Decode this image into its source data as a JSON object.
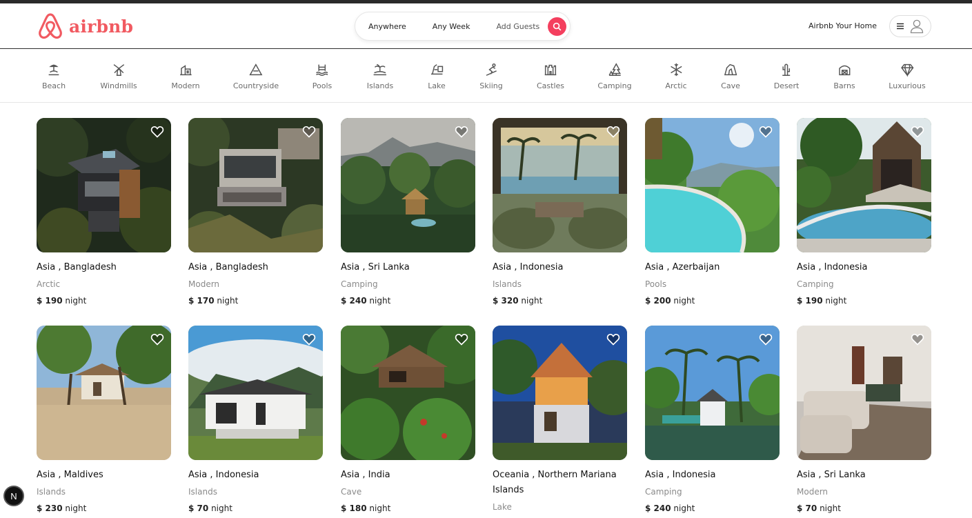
{
  "brand": {
    "name": "airbnb",
    "logo_icon": "airbnb-logo-icon",
    "color": "#F15A61"
  },
  "search": {
    "where": "Anywhere",
    "when": "Any Week",
    "who": "Add Guests",
    "button_icon": "search-icon",
    "accent": "#F43F5E"
  },
  "header": {
    "host_label": "Airbnb Your Home",
    "menu_icon": "hamburger-menu-icon",
    "avatar_icon": "user-avatar-icon"
  },
  "categories": [
    {
      "label": "Beach",
      "icon": "beach-icon"
    },
    {
      "label": "Windmills",
      "icon": "windmill-icon"
    },
    {
      "label": "Modern",
      "icon": "modern-house-icon"
    },
    {
      "label": "Countryside",
      "icon": "mountain-icon"
    },
    {
      "label": "Pools",
      "icon": "pool-icon"
    },
    {
      "label": "Islands",
      "icon": "island-icon"
    },
    {
      "label": "Lake",
      "icon": "lake-icon"
    },
    {
      "label": "Skiing",
      "icon": "skiing-icon"
    },
    {
      "label": "Castles",
      "icon": "castle-icon"
    },
    {
      "label": "Camping",
      "icon": "camping-icon"
    },
    {
      "label": "Arctic",
      "icon": "snowflake-icon"
    },
    {
      "label": "Cave",
      "icon": "cave-icon"
    },
    {
      "label": "Desert",
      "icon": "cactus-icon"
    },
    {
      "label": "Barns",
      "icon": "barn-icon"
    },
    {
      "label": "Luxurious",
      "icon": "diamond-icon"
    }
  ],
  "listings": [
    {
      "location": "Asia , Bangladesh",
      "category": "Arctic",
      "price": "$ 190",
      "unit": "night"
    },
    {
      "location": "Asia , Bangladesh",
      "category": "Modern",
      "price": "$ 170",
      "unit": "night"
    },
    {
      "location": "Asia , Sri Lanka",
      "category": "Camping",
      "price": "$ 240",
      "unit": "night"
    },
    {
      "location": "Asia , Indonesia",
      "category": "Islands",
      "price": "$ 320",
      "unit": "night"
    },
    {
      "location": "Asia , Azerbaijan",
      "category": "Pools",
      "price": "$ 200",
      "unit": "night"
    },
    {
      "location": "Asia , Indonesia",
      "category": "Camping",
      "price": "$ 190",
      "unit": "night"
    },
    {
      "location": "Asia , Maldives",
      "category": "Islands",
      "price": "$ 230",
      "unit": "night"
    },
    {
      "location": "Asia , Indonesia",
      "category": "Islands",
      "price": "$ 70",
      "unit": "night"
    },
    {
      "location": "Asia , India",
      "category": "Cave",
      "price": "$ 180",
      "unit": "night"
    },
    {
      "location": "Oceania , Northern Mariana Islands",
      "category": "Lake",
      "price": "",
      "unit": ""
    },
    {
      "location": "Asia , Indonesia",
      "category": "Camping",
      "price": "$ 240",
      "unit": "night"
    },
    {
      "location": "Asia , Sri Lanka",
      "category": "Modern",
      "price": "$ 70",
      "unit": "night"
    }
  ],
  "dev_badge": {
    "label": "N"
  }
}
